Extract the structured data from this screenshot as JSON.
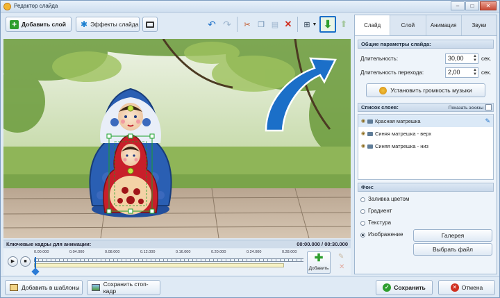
{
  "window": {
    "title": "Редактор слайда",
    "controls": {
      "minimize": "–",
      "maximize": "□",
      "close": "✕"
    }
  },
  "toolbar": {
    "add_layer": "Добавить слой",
    "slide_effects": "Эффекты слайда"
  },
  "keyframes": {
    "label": "Ключевые кадры для анимации:",
    "time": "00:00.000 / 00:30.000",
    "ticks": [
      "0.00.000",
      "0.04.000",
      "0.08.000",
      "0.12.000",
      "0.16.000",
      "0.20.000",
      "0.24.000",
      "0.28.000"
    ],
    "add_label": "Добавить"
  },
  "panel": {
    "tabs": [
      "Слайд",
      "Слой",
      "Анимация",
      "Звуки"
    ],
    "general_header": "Общие параметры слайда:",
    "duration_label": "Длительность:",
    "duration_value": "30,00",
    "transition_label": "Длительность перехода:",
    "transition_value": "2,00",
    "unit": "сек.",
    "music_volume_button": "Установить громкость музыки",
    "layers_header": "Список слоев:",
    "show_thumbs": "Показать эскизы",
    "layers": [
      "Красная матрешка",
      "Синяя матрешка - верх",
      "Синяя матрешка - низ"
    ],
    "bg_header": "Фон:",
    "bg_options": [
      "Заливка цветом",
      "Градиент",
      "Текстура",
      "Изображение"
    ],
    "gallery_button": "Галерея",
    "choose_file_button": "Выбрать файл"
  },
  "bottom": {
    "add_template": "Добавить в шаблоны",
    "save_stopframe": "Сохранить стоп-кадр",
    "save": "Сохранить",
    "cancel": "Отмена"
  },
  "colors": {
    "accent_green": "#2e9e2e",
    "arrow_blue": "#1b6fc8",
    "cancel_red": "#d03020"
  }
}
